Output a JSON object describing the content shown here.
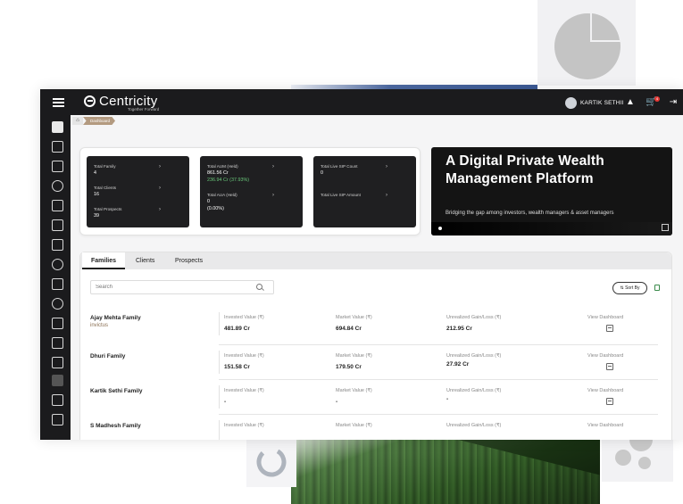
{
  "app": {
    "brand": "Centricity",
    "tagline": "Together Forward",
    "user_name": "KARTIK SETHII",
    "cart_count": "4"
  },
  "breadcrumb": {
    "current": "Dashboard"
  },
  "stats": {
    "cards": [
      {
        "items": [
          {
            "label": "Total Family",
            "value": "4"
          },
          {
            "label": "Total Clients",
            "value": "16"
          },
          {
            "label": "Total Prospects",
            "value": "39"
          }
        ]
      },
      {
        "items": [
          {
            "label": "Total AUM (Held)",
            "value": "861.56 Cr",
            "sub": "236.94 Cr (37.93%)"
          },
          {
            "label": "Total AUA (Held)",
            "value": "0",
            "sub": "(0.00%)"
          }
        ]
      },
      {
        "items": [
          {
            "label": "Total Live SIP Count",
            "value": "0"
          },
          {
            "label": "Total Live SIP Amount",
            "value": ""
          }
        ]
      }
    ]
  },
  "hero": {
    "title": "A Digital Private Wealth Management Platform",
    "subtitle": "Bridging the gap among investors, wealth managers & asset managers"
  },
  "tabs": [
    "Families",
    "Clients",
    "Prospects"
  ],
  "search": {
    "placeholder": "Search"
  },
  "sort_label": "Sort By",
  "columns": {
    "invested": "Invested Value (₹)",
    "market": "Market Value (₹)",
    "gain": "Unrealized Gain/Loss (₹)",
    "view": "View Dashboard"
  },
  "families": [
    {
      "name": "Ajay Mehta Family",
      "sub": "invictus",
      "invested": "481.89 Cr",
      "market": "694.84 Cr",
      "gain": "212.95 Cr"
    },
    {
      "name": "Dhuri Family",
      "sub": "",
      "invested": "151.58 Cr",
      "market": "179.50 Cr",
      "gain": "27.92 Cr"
    },
    {
      "name": "Kartik Sethi Family",
      "sub": "",
      "invested": "-",
      "market": "-",
      "gain": "-"
    },
    {
      "name": "S Madhesh Family",
      "sub": "",
      "invested": "",
      "market": "",
      "gain": ""
    }
  ],
  "icons": {
    "menu": "hamburger-icon",
    "logo": "centricity-logo-icon",
    "avatar": "user-avatar-icon",
    "notification": "bell-icon",
    "cart": "cart-icon",
    "logout": "logout-icon",
    "home": "home-icon",
    "search": "search-icon",
    "sort": "sort-icon",
    "export": "excel-export-icon",
    "view": "dashboard-view-icon"
  },
  "colors": {
    "topbar": "#1b1b1d",
    "accent": "#b39a80",
    "positive": "#69c87a"
  }
}
